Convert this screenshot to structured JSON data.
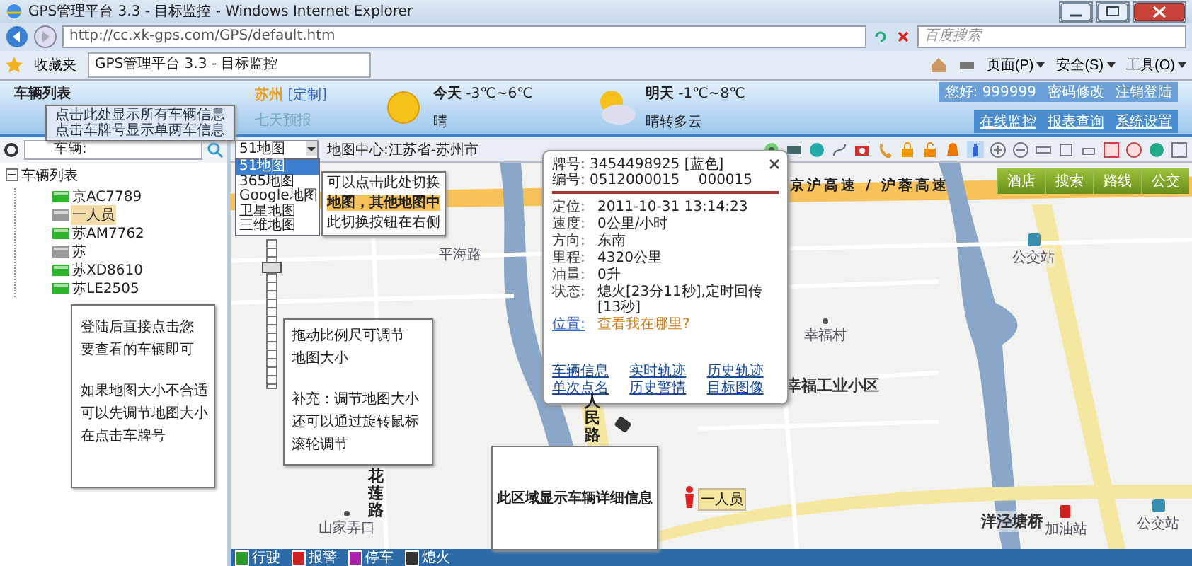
{
  "window": {
    "title": "GPS管理平台 3.3 - 目标监控 - Windows Internet Explorer"
  },
  "address_bar": {
    "url": "http://cc.xk-gps.com/GPS/default.htm",
    "search_placeholder": "百度搜索"
  },
  "favorites_bar": {
    "favorites": "收藏夹",
    "tab": "GPS管理平台 3.3 - 目标监控",
    "menus": [
      "页面(P)",
      "安全(S)",
      "工具(O)"
    ]
  },
  "header": {
    "panel_title": "车辆列表",
    "city": "苏州",
    "custom": "[定制]",
    "forecast": "七天预报",
    "weather": [
      {
        "kind": "sunny",
        "day": "今天",
        "temp": "-3℃~6℃",
        "desc": "晴"
      },
      {
        "kind": "cloudy",
        "day": "明天",
        "temp": "-1℃~8℃",
        "desc": "晴转多云"
      }
    ],
    "user_links": [
      "您好: 999999",
      "密码修改",
      "注销登陆"
    ],
    "nav": [
      "在线监控",
      "报表查询",
      "系统设置"
    ]
  },
  "sidebar": {
    "search_label": "车辆:",
    "tree": {
      "label": "车辆列表",
      "expanded": true,
      "children": [
        {
          "label": "京AC7789",
          "online": true,
          "selected": false
        },
        {
          "label": "一人员",
          "online": false,
          "selected": true
        },
        {
          "label": "苏AM7762",
          "online": true,
          "selected": false
        },
        {
          "label": "苏",
          "online": false,
          "selected": false
        },
        {
          "label": "苏XD8610",
          "online": true,
          "selected": false
        },
        {
          "label": "苏LE2505",
          "online": true,
          "selected": false
        }
      ]
    },
    "callouts": [
      {
        "lines": [
          "点击此处显示所有车辆信息",
          "点击车牌号显示单两车信息"
        ]
      },
      {
        "paragraphs": [
          [
            "登陆后直接点击您",
            "要查看的车辆即可"
          ],
          [
            "如果地图大小不合适",
            "可以先调节地图大小",
            "在点击车牌号"
          ]
        ]
      }
    ]
  },
  "map": {
    "map_type": "51地图",
    "map_options": [
      {
        "label": "51地图",
        "selected": true
      },
      {
        "label": "365地图",
        "selected": false
      },
      {
        "label": "Google地图",
        "selected": false
      },
      {
        "label": "卫星地图",
        "selected": false
      },
      {
        "label": "三维地图",
        "selected": false
      }
    ],
    "center": "地图中心:江苏省-苏州市",
    "zoom": {
      "level": 0.88
    },
    "highway": "京沪高速 / 沪蓉高速",
    "map_buttons": [
      "酒店",
      "搜索",
      "路线",
      "公交"
    ],
    "labels": [
      {
        "text": "平海路",
        "kind": "road"
      },
      {
        "text": "公交站",
        "kind": "bus"
      },
      {
        "text": "幸福村",
        "kind": "poi"
      },
      {
        "text": "幸福工业小区",
        "kind": "area"
      },
      {
        "text": "山家弄口",
        "kind": "poi"
      },
      {
        "text": "洋泾塘桥",
        "kind": "area"
      },
      {
        "text": "加油站",
        "kind": "fuel"
      },
      {
        "text": "公交站",
        "kind": "bus"
      }
    ],
    "vertical_roads": [
      "人民路",
      "花莲路"
    ],
    "person_tag": "一人员",
    "callouts": [
      {
        "lines": [
          "可以点击此处切换",
          "**地图，其他地图中**",
          "此切换按钮在右侧"
        ]
      },
      {
        "paragraphs": [
          [
            "拖动比例尺可调节",
            "地图大小"
          ],
          [
            "补充：调节地图大小",
            "还可以通过旋转鼠标",
            "滚轮调节"
          ]
        ]
      },
      {
        "lines": [
          "此区域显示车辆详细信息"
        ]
      }
    ],
    "popup": {
      "plate_label": "牌号:",
      "plate": "3454498925 [蓝色]",
      "id_label": "编号:",
      "id": "0512000015　 000015",
      "fields": [
        {
          "label": "定位:",
          "value": "2011-10-31 13:14:23"
        },
        {
          "label": "速度:",
          "value": "0公里/小时"
        },
        {
          "label": "方向:",
          "value": "东南"
        },
        {
          "label": "里程:",
          "value": "4320公里"
        },
        {
          "label": "油量:",
          "value": "0升"
        },
        {
          "label": "状态:",
          "value": "熄火[23分11秒],定时回传[13秒]"
        }
      ],
      "location_label": "位置:",
      "location_link": "查看我在哪里?",
      "links": [
        "车辆信息",
        "实时轨迹",
        "历史轨迹",
        "单次点名",
        "历史警情",
        "目标图像"
      ]
    },
    "legend": [
      {
        "label": "行驶",
        "color": "#2a9a2a"
      },
      {
        "label": "报警",
        "color": "#cc2222"
      },
      {
        "label": "停车",
        "color": "#aa22aa"
      },
      {
        "label": "熄火",
        "color": "#333333"
      }
    ]
  }
}
